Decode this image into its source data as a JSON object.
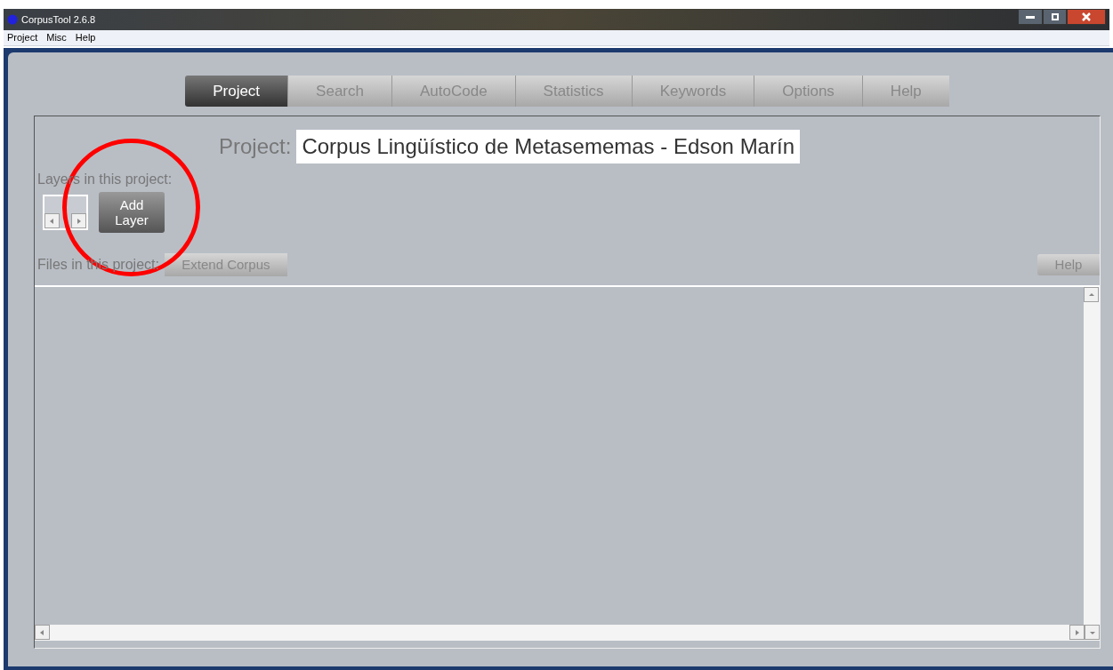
{
  "window": {
    "title": "CorpusTool 2.6.8"
  },
  "menu": [
    "Project",
    "Misc",
    "Help"
  ],
  "tabs": [
    {
      "label": "Project",
      "selected": true
    },
    {
      "label": "Search",
      "selected": false
    },
    {
      "label": "AutoCode",
      "selected": false
    },
    {
      "label": "Statistics",
      "selected": false
    },
    {
      "label": "Keywords",
      "selected": false
    },
    {
      "label": "Options",
      "selected": false
    },
    {
      "label": "Help",
      "selected": false
    }
  ],
  "project": {
    "label": "Project:",
    "name": "Corpus Lingüístico de Metasememas - Edson Marín"
  },
  "layers": {
    "label": "Layers in this project:",
    "add_button": "Add\nLayer"
  },
  "files": {
    "label": "Files in this project:",
    "extend_button": "Extend Corpus",
    "help_button": "Help"
  }
}
